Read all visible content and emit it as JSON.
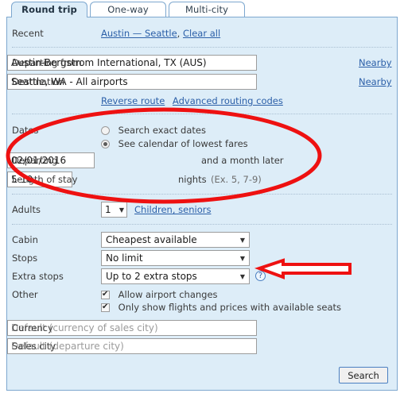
{
  "tabs": [
    {
      "label": "Round trip",
      "active": true
    },
    {
      "label": "One-way",
      "active": false
    },
    {
      "label": "Multi-city",
      "active": false
    }
  ],
  "recent": {
    "label": "Recent",
    "route_link": "Austin — Seattle",
    "separator": ",",
    "clear_link": "Clear all"
  },
  "route": {
    "departing_from_label": "Departing from",
    "departing_from_value": "Austin-Bergstrom International, TX (AUS)",
    "departing_from_nearby": "Nearby",
    "destination_label": "Destination",
    "destination_value": "Seattle, WA - All airports",
    "destination_nearby": "Nearby",
    "reverse_route_link": "Reverse route",
    "advanced_codes_link": "Advanced routing codes"
  },
  "dates": {
    "label": "Dates",
    "exact_option": "Search exact dates",
    "exact_selected": false,
    "calendar_option": "See calendar of lowest fares",
    "calendar_selected": true,
    "departing_label": "Departing",
    "departing_value": "02/01/2016",
    "departing_suffix": "and a month later",
    "length_label": "Length of stay",
    "length_value": "5-10",
    "nights_text": "nights",
    "nights_example": "(Ex. 5, 7-9)"
  },
  "passengers": {
    "adults_label": "Adults",
    "adults_value": "1",
    "children_link": "Children, seniors"
  },
  "options": {
    "cabin_label": "Cabin",
    "cabin_value": "Cheapest available",
    "stops_label": "Stops",
    "stops_value": "No limit",
    "extra_stops_label": "Extra stops",
    "extra_stops_value": "Up to 2 extra stops",
    "help_icon": "question-mark-circle-icon",
    "other_label": "Other",
    "allow_airport_changes": "Allow airport changes",
    "allow_airport_changes_checked": true,
    "only_available_seats": "Only show flights and prices with available seats",
    "only_available_seats_checked": true
  },
  "locale": {
    "currency_label": "Currency",
    "currency_placeholder": "Default (currency of sales city)",
    "currency_value": "",
    "sales_city_label": "Sales city",
    "sales_city_placeholder": "Default (departure city)",
    "sales_city_value": ""
  },
  "actions": {
    "search_label": "Search"
  },
  "annotations": {
    "ellipse_color": "#ee1111",
    "arrow_color": "#ee1111",
    "ellipse_target": "dates-section",
    "arrow_target": "stops-dropdown"
  },
  "colors": {
    "panel_background": "#ddedf8",
    "panel_border": "#7da7cf",
    "link": "#2b5fa8",
    "annotation_red": "#ee1111"
  }
}
